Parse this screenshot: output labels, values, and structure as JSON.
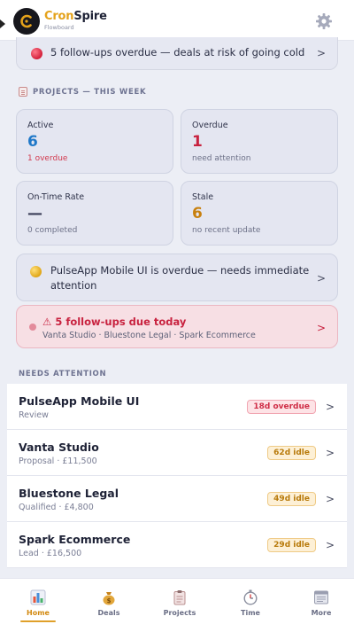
{
  "app": {
    "brand_part1": "Cron",
    "brand_part2": "Spire",
    "brand_sub": "Flowboard"
  },
  "top_alert": {
    "text": "5 follow-ups overdue — deals at risk of going cold"
  },
  "projects_section": {
    "title": "PROJECTS — THIS WEEK",
    "cards": [
      {
        "label": "Active",
        "value": "6",
        "sub": "1 overdue",
        "value_color": "#1f78c8",
        "sub_color": "#d23a4f"
      },
      {
        "label": "Overdue",
        "value": "1",
        "sub": "need attention",
        "value_color": "#c8223f",
        "sub_color": "#6d7188"
      },
      {
        "label": "On-Time Rate",
        "value": "—",
        "sub": "0 completed",
        "value_color": "#3a3e58",
        "sub_color": "#6d7188"
      },
      {
        "label": "Stale",
        "value": "6",
        "sub": "no recent update",
        "value_color": "#c8800e",
        "sub_color": "#6d7188"
      }
    ]
  },
  "overdue_alert": {
    "text": "PulseApp Mobile UI is overdue — needs immediate attention"
  },
  "followups": {
    "title": "⚠ 5 follow-ups due today",
    "sub": "Vanta Studio · Bluestone Legal · Spark Ecommerce"
  },
  "needs_attention": {
    "title": "NEEDS ATTENTION",
    "rows": [
      {
        "name": "PulseApp Mobile UI",
        "meta": "Review",
        "badge": "18d overdue",
        "badge_type": "red"
      },
      {
        "name": "Vanta Studio",
        "meta": "Proposal · £11,500",
        "badge": "62d idle",
        "badge_type": "amber"
      },
      {
        "name": "Bluestone Legal",
        "meta": "Qualified · £4,800",
        "badge": "49d idle",
        "badge_type": "amber"
      },
      {
        "name": "Spark Ecommerce",
        "meta": "Lead · £16,500",
        "badge": "29d idle",
        "badge_type": "amber"
      }
    ]
  },
  "nav": {
    "items": [
      {
        "label": "Home",
        "icon": "chart-icon"
      },
      {
        "label": "Deals",
        "icon": "money-bag-icon"
      },
      {
        "label": "Projects",
        "icon": "clipboard-icon"
      },
      {
        "label": "Time",
        "icon": "stopwatch-icon"
      },
      {
        "label": "More",
        "icon": "menu-card-icon"
      }
    ],
    "active": "Home"
  },
  "colors": {
    "accent": "#e0a02a",
    "danger": "#c8223f",
    "background": "#eceef5"
  }
}
